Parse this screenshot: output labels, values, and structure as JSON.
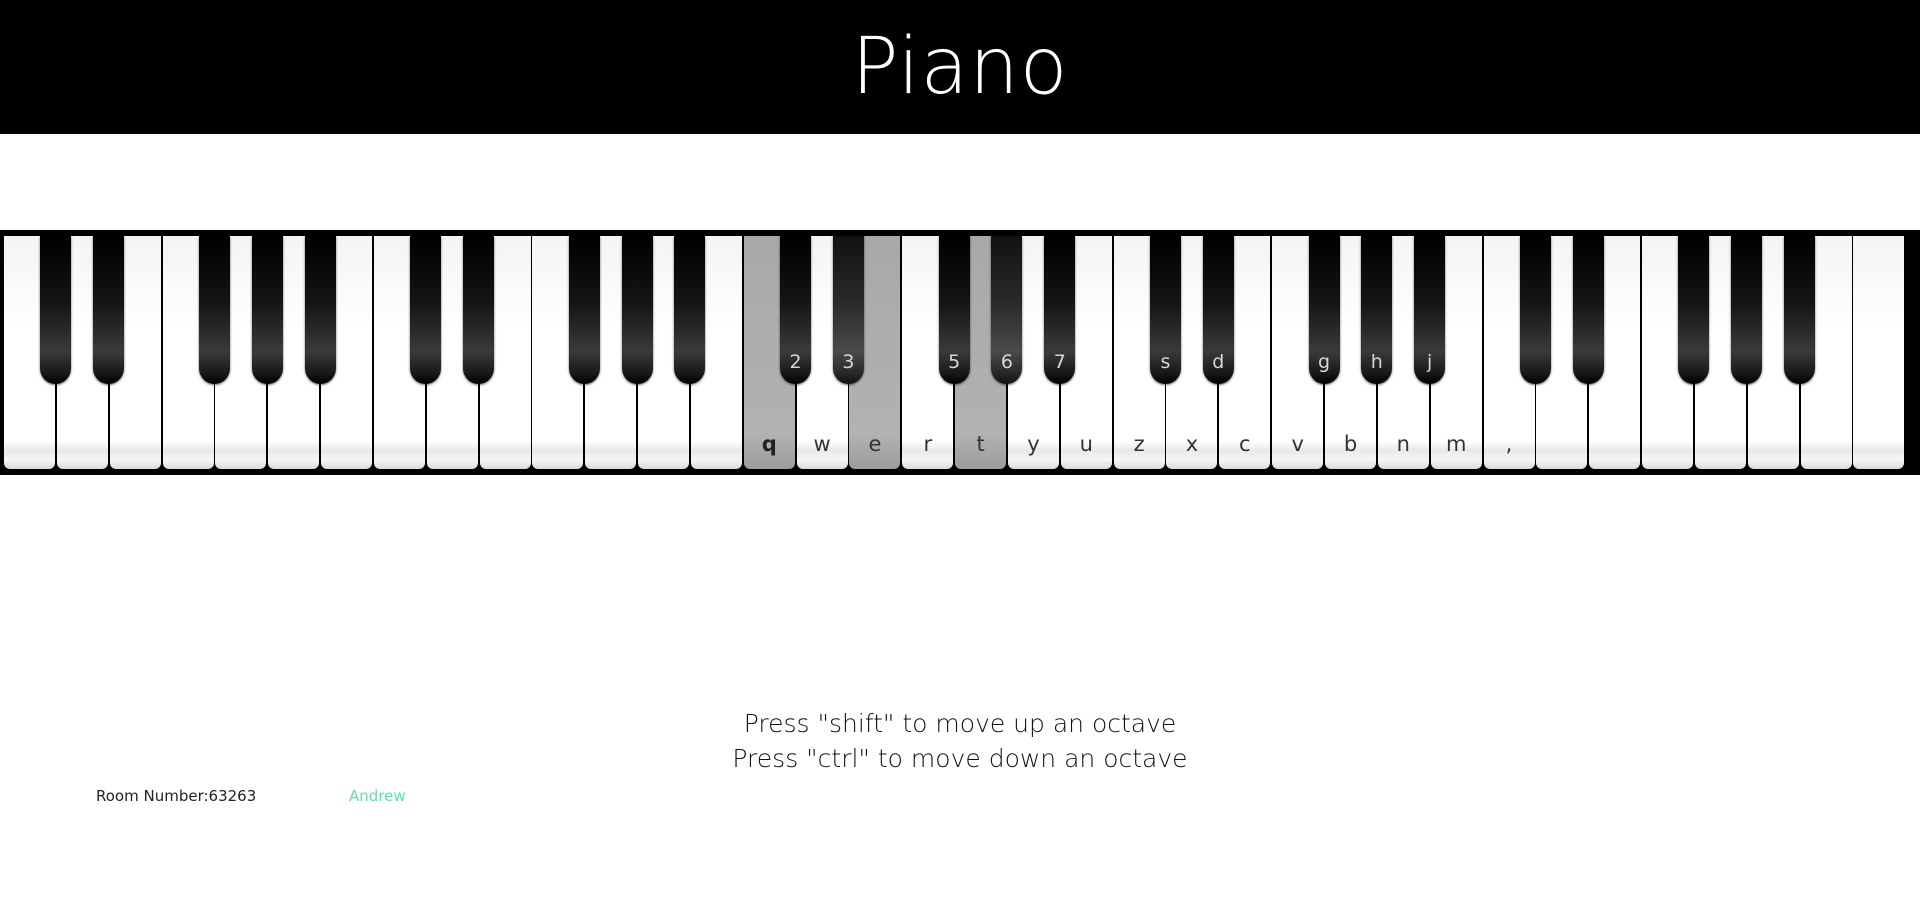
{
  "header": {
    "title": "Piano"
  },
  "piano": {
    "white_keys": [
      {
        "label": "",
        "pressed": false
      },
      {
        "label": "",
        "pressed": false
      },
      {
        "label": "",
        "pressed": false
      },
      {
        "label": "",
        "pressed": false
      },
      {
        "label": "",
        "pressed": false
      },
      {
        "label": "",
        "pressed": false
      },
      {
        "label": "",
        "pressed": false
      },
      {
        "label": "",
        "pressed": false
      },
      {
        "label": "",
        "pressed": false
      },
      {
        "label": "",
        "pressed": false
      },
      {
        "label": "",
        "pressed": false
      },
      {
        "label": "",
        "pressed": false
      },
      {
        "label": "",
        "pressed": false
      },
      {
        "label": "",
        "pressed": false
      },
      {
        "label": "q",
        "pressed": true
      },
      {
        "label": "w",
        "pressed": false
      },
      {
        "label": "e",
        "pressed": true
      },
      {
        "label": "r",
        "pressed": false
      },
      {
        "label": "t",
        "pressed": true
      },
      {
        "label": "y",
        "pressed": false
      },
      {
        "label": "u",
        "pressed": false
      },
      {
        "label": "z",
        "pressed": false
      },
      {
        "label": "x",
        "pressed": false
      },
      {
        "label": "c",
        "pressed": false
      },
      {
        "label": "v",
        "pressed": false
      },
      {
        "label": "b",
        "pressed": false
      },
      {
        "label": "n",
        "pressed": false
      },
      {
        "label": "m",
        "pressed": false
      },
      {
        "label": ",",
        "pressed": false
      },
      {
        "label": "",
        "pressed": false
      },
      {
        "label": "",
        "pressed": false
      },
      {
        "label": "",
        "pressed": false
      },
      {
        "label": "",
        "pressed": false
      },
      {
        "label": "",
        "pressed": false
      },
      {
        "label": "",
        "pressed": false
      },
      {
        "label": "",
        "pressed": false
      }
    ],
    "black_keys": [
      {
        "label": "",
        "pressed": false
      },
      {
        "label": "",
        "pressed": false
      },
      {
        "label": "",
        "pressed": false
      },
      {
        "label": "",
        "pressed": false
      },
      {
        "label": "",
        "pressed": false
      },
      {
        "label": "",
        "pressed": false
      },
      {
        "label": "",
        "pressed": false
      },
      {
        "label": "",
        "pressed": false
      },
      {
        "label": "",
        "pressed": false
      },
      {
        "label": "",
        "pressed": false
      },
      {
        "label": "2",
        "pressed": false
      },
      {
        "label": "3",
        "pressed": true
      },
      {
        "label": "5",
        "pressed": false
      },
      {
        "label": "6",
        "pressed": true
      },
      {
        "label": "7",
        "pressed": false
      },
      {
        "label": "s",
        "pressed": false
      },
      {
        "label": "d",
        "pressed": false
      },
      {
        "label": "g",
        "pressed": false
      },
      {
        "label": "h",
        "pressed": false
      },
      {
        "label": "j",
        "pressed": false
      },
      {
        "label": "",
        "pressed": false
      },
      {
        "label": "",
        "pressed": false
      },
      {
        "label": "",
        "pressed": false
      },
      {
        "label": "",
        "pressed": false
      },
      {
        "label": "",
        "pressed": false
      }
    ]
  },
  "instructions": {
    "line1": "Press \"shift\" to move up an octave",
    "line2": "Press \"ctrl\" to move down an octave"
  },
  "footer": {
    "room": "Room Number:63263",
    "user": "Andrew"
  },
  "colors": {
    "header_bg": "#000000",
    "user_name": "#66ddaa",
    "pressed_key": "#b0b0b0"
  }
}
